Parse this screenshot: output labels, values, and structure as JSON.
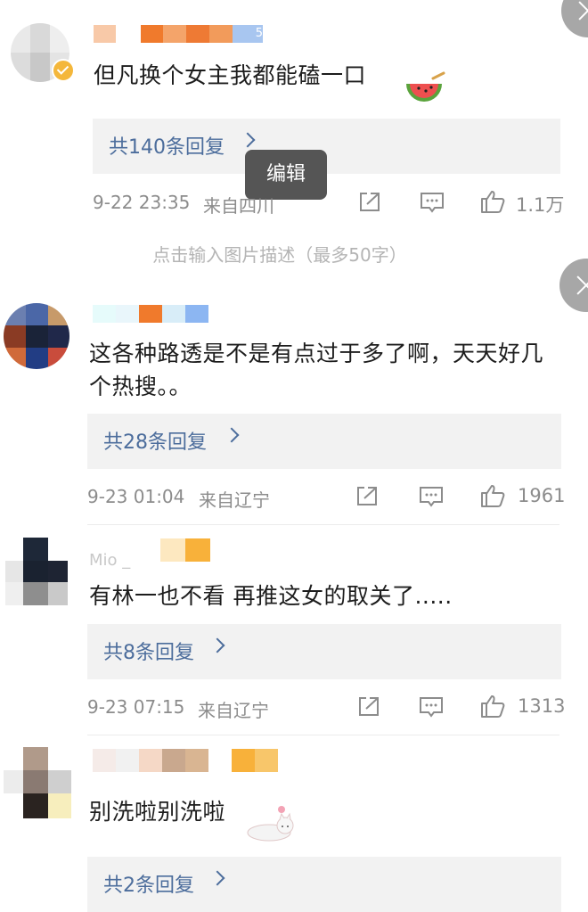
{
  "comments": [
    {
      "text": "但凡换个女主我都能磕一口",
      "reply_label": "共140条回复",
      "time": "9-22 23:35",
      "location": "来自四川",
      "likes": "1.1万",
      "name_badge": "5",
      "sticker": "watermelon-sticker"
    },
    {
      "text": "这各种路透是不是有点过于多了啊，天天好几个热搜。。",
      "reply_label": "共28条回复",
      "time": "9-23 01:04",
      "location": "来自辽宁",
      "likes": "1961"
    },
    {
      "text": "有林一也不看 再推这女的取关了.....",
      "reply_label": "共8条回复",
      "time": "9-23 07:15",
      "location": "来自辽宁",
      "likes": "1313",
      "name_partial": "Mio _"
    },
    {
      "text": "别洗啦别洗啦",
      "reply_label": "共2条回复",
      "sticker": "cat-sticker"
    }
  ],
  "popover": {
    "label": "编辑"
  },
  "image_caption": "点击输入图片描述（最多50字）",
  "colors": {
    "link": "#4c6d9c",
    "meta": "#8c8c8c",
    "reply_bg": "#f2f2f2"
  },
  "icons": [
    "share-icon",
    "comment-icon",
    "like-icon",
    "close-icon",
    "verified-badge-icon"
  ]
}
